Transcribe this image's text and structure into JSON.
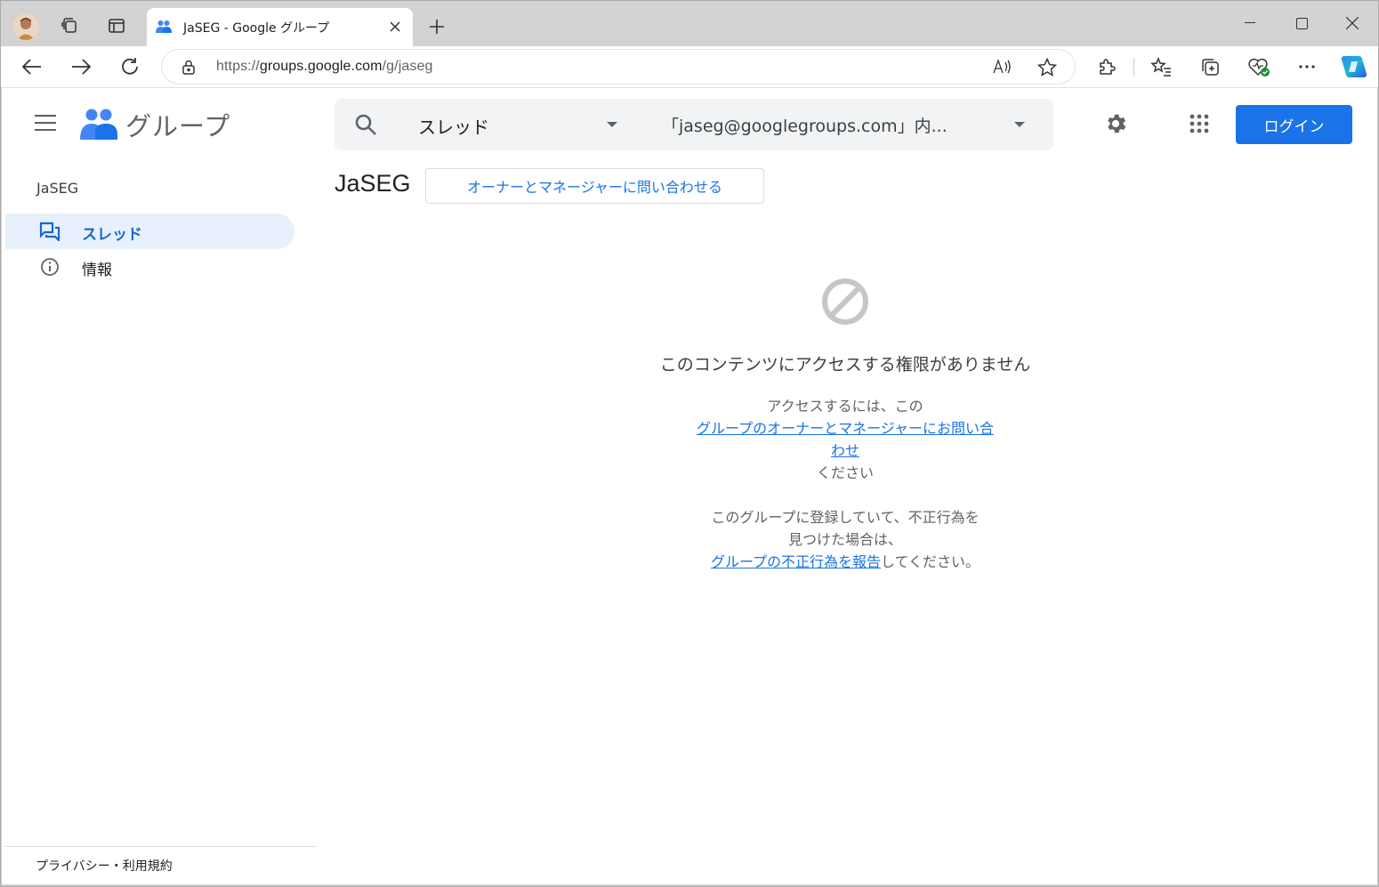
{
  "browser": {
    "tab_title": "JaSEG - Google グループ",
    "url_scheme": "https://",
    "url_host": "groups.google.com",
    "url_path": "/g/jaseg",
    "accent": "#1a73e8"
  },
  "app": {
    "logo_text": "グループ",
    "search_scope": "スレッド",
    "search_query": "「jaseg@googlegroups.com」内...",
    "login_label": "ログイン"
  },
  "sidebar": {
    "group_name": "JaSEG",
    "items": [
      {
        "label": "スレッド",
        "icon": "forum-icon",
        "active": true
      },
      {
        "label": "情報",
        "icon": "info-icon",
        "active": false
      }
    ],
    "footer": "プライバシー・利用規約"
  },
  "main": {
    "group_title": "JaSEG",
    "contact_button": "オーナーとマネージャーに問い合わせる",
    "denied_title": "このコンテンツにアクセスする権限がありません",
    "access_prefix": "アクセスするには、この",
    "access_link": "グループのオーナーとマネージャーにお問い合わせ",
    "access_suffix": "ください",
    "report_line1": "このグループに登録していて、不正行為を",
    "report_line2": "見つけた場合は、",
    "report_link": "グループの不正行為を報告",
    "report_suffix": "してください。"
  }
}
